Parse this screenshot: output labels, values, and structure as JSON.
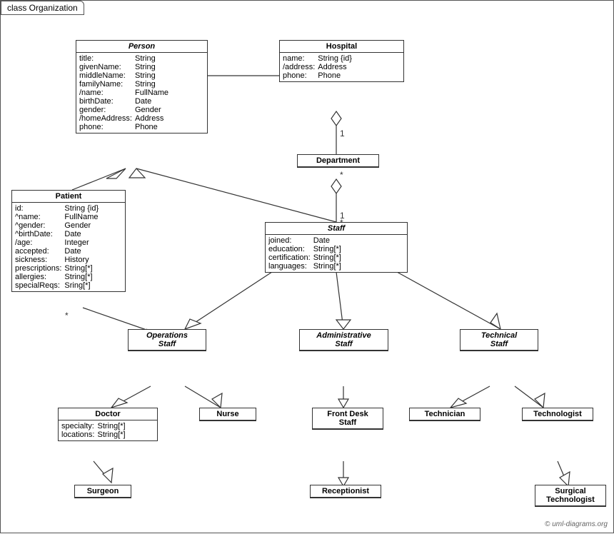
{
  "diagram": {
    "title": "class Organization",
    "copyright": "© uml-diagrams.org",
    "classes": {
      "person": {
        "name": "Person",
        "italic": true,
        "attributes": [
          [
            "title:",
            "String"
          ],
          [
            "givenName:",
            "String"
          ],
          [
            "middleName:",
            "String"
          ],
          [
            "familyName:",
            "String"
          ],
          [
            "/name:",
            "FullName"
          ],
          [
            "birthDate:",
            "Date"
          ],
          [
            "gender:",
            "Gender"
          ],
          [
            "/homeAddress:",
            "Address"
          ],
          [
            "phone:",
            "Phone"
          ]
        ]
      },
      "hospital": {
        "name": "Hospital",
        "italic": false,
        "attributes": [
          [
            "name:",
            "String {id}"
          ],
          [
            "/address:",
            "Address"
          ],
          [
            "phone:",
            "Phone"
          ]
        ]
      },
      "department": {
        "name": "Department",
        "italic": false,
        "attributes": []
      },
      "staff": {
        "name": "Staff",
        "italic": true,
        "attributes": [
          [
            "joined:",
            "Date"
          ],
          [
            "education:",
            "String[*]"
          ],
          [
            "certification:",
            "String[*]"
          ],
          [
            "languages:",
            "String[*]"
          ]
        ]
      },
      "patient": {
        "name": "Patient",
        "italic": false,
        "attributes": [
          [
            "id:",
            "String {id}"
          ],
          [
            "^name:",
            "FullName"
          ],
          [
            "^gender:",
            "Gender"
          ],
          [
            "^birthDate:",
            "Date"
          ],
          [
            "/age:",
            "Integer"
          ],
          [
            "accepted:",
            "Date"
          ],
          [
            "sickness:",
            "History"
          ],
          [
            "prescriptions:",
            "String[*]"
          ],
          [
            "allergies:",
            "String[*]"
          ],
          [
            "specialReqs:",
            "Sring[*]"
          ]
        ]
      },
      "operations_staff": {
        "name": "Operations\nStaff",
        "italic": true,
        "attributes": []
      },
      "administrative_staff": {
        "name": "Administrative\nStaff",
        "italic": true,
        "attributes": []
      },
      "technical_staff": {
        "name": "Technical\nStaff",
        "italic": true,
        "attributes": []
      },
      "doctor": {
        "name": "Doctor",
        "italic": false,
        "attributes": [
          [
            "specialty:",
            "String[*]"
          ],
          [
            "locations:",
            "String[*]"
          ]
        ]
      },
      "nurse": {
        "name": "Nurse",
        "italic": false,
        "attributes": []
      },
      "front_desk_staff": {
        "name": "Front Desk\nStaff",
        "italic": false,
        "attributes": []
      },
      "technician": {
        "name": "Technician",
        "italic": false,
        "attributes": []
      },
      "technologist": {
        "name": "Technologist",
        "italic": false,
        "attributes": []
      },
      "surgeon": {
        "name": "Surgeon",
        "italic": false,
        "attributes": []
      },
      "receptionist": {
        "name": "Receptionist",
        "italic": false,
        "attributes": []
      },
      "surgical_technologist": {
        "name": "Surgical\nTechnologist",
        "italic": false,
        "attributes": []
      }
    }
  }
}
